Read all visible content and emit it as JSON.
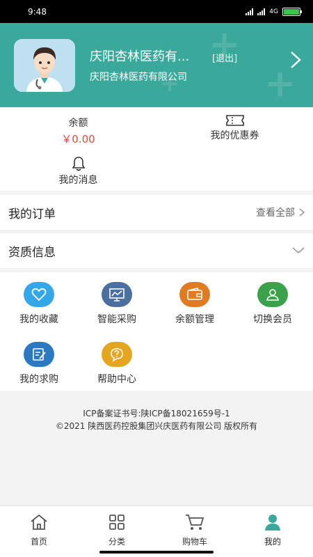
{
  "status_bar": {
    "time": "9:48",
    "network": "4G"
  },
  "header": {
    "user_name": "庆阳杏林医药有...",
    "logout_label": "[退出]",
    "company": "庆阳杏林医药有限公司"
  },
  "wallet": {
    "balance_label": "余额",
    "balance_value": "￥0.00",
    "coupon_label": "我的优惠券",
    "message_label": "我的消息"
  },
  "orders": {
    "title": "我的订单",
    "view_all": "查看全部"
  },
  "qualification": {
    "title": "资质信息"
  },
  "features": [
    {
      "label": "我的收藏",
      "icon": "heart-icon",
      "color": "#35a7e8"
    },
    {
      "label": "智能采购",
      "icon": "chart-board-icon",
      "color": "#4b6f9f"
    },
    {
      "label": "余额管理",
      "icon": "wallet-icon",
      "color": "#e07b22"
    },
    {
      "label": "切换会员",
      "icon": "user-switch-icon",
      "color": "#3ba24b"
    },
    {
      "label": "我的求购",
      "icon": "edit-note-icon",
      "color": "#2a79c2"
    },
    {
      "label": "帮助中心",
      "icon": "help-chat-icon",
      "color": "#e4a51f"
    }
  ],
  "footer": {
    "icp": "ICP备案证书号:陕ICP备18021659号-1",
    "copyright": "©2021 陕西医药控股集团兴庆医药有限公司 版权所有"
  },
  "tabs": [
    {
      "label": "首页",
      "icon": "home-icon"
    },
    {
      "label": "分类",
      "icon": "category-grid-icon"
    },
    {
      "label": "购物车",
      "icon": "cart-icon"
    },
    {
      "label": "我的",
      "icon": "profile-icon",
      "active": true
    }
  ],
  "colors": {
    "header_bg": "#3aa89b",
    "balance_red": "#e0463b",
    "tab_active": "#3aa89b"
  }
}
